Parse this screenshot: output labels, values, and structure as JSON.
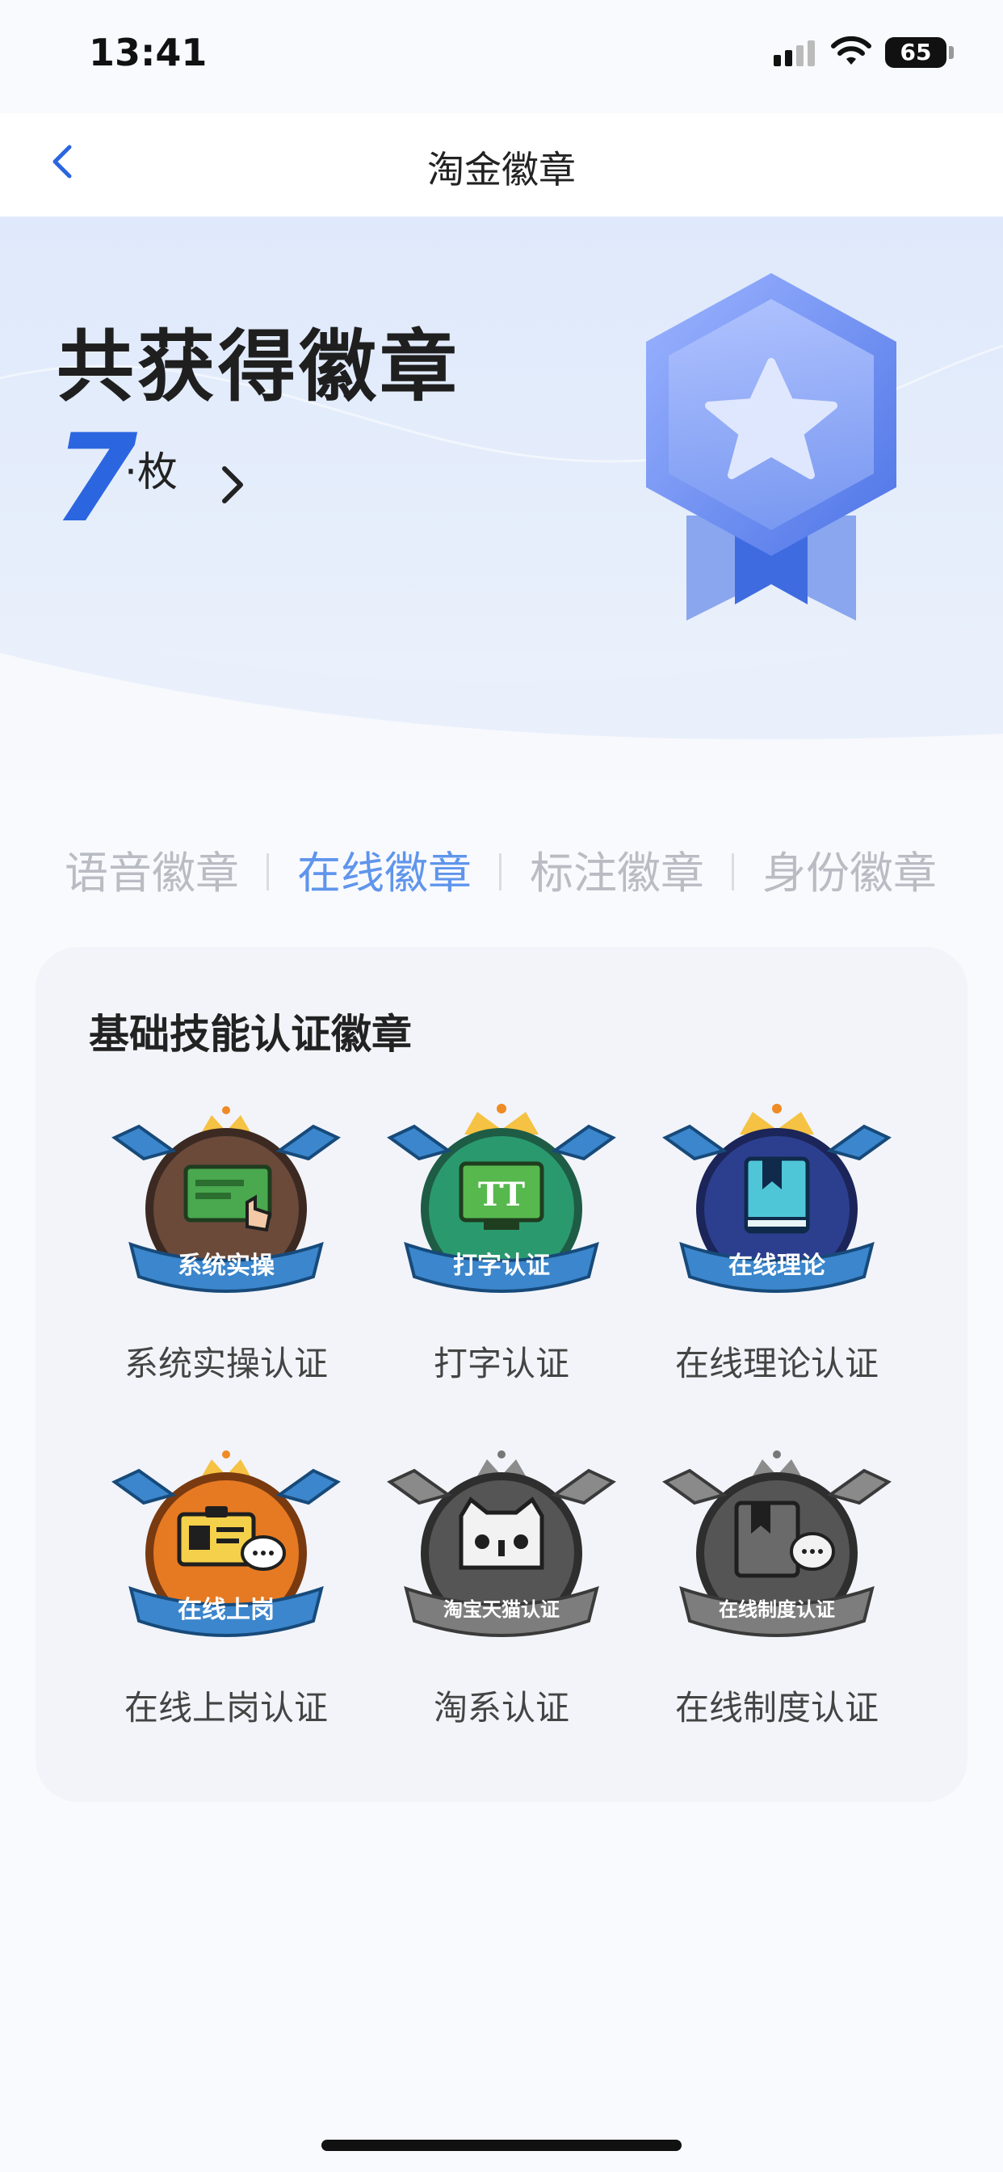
{
  "status_bar": {
    "time": "13:41",
    "battery": "65"
  },
  "nav": {
    "title": "淘金徽章"
  },
  "hero": {
    "title": "共获得徽章",
    "count": "7",
    "unit": "·枚"
  },
  "tabs": [
    {
      "label": "语音徽章",
      "active": false
    },
    {
      "label": "在线徽章",
      "active": true
    },
    {
      "label": "标注徽章",
      "active": false
    },
    {
      "label": "身份徽章",
      "active": false
    }
  ],
  "section": {
    "title": "基础技能认证徽章",
    "badges": [
      {
        "label": "系统实操认证",
        "ribbon": "系统实操",
        "icon": "screen-hand-icon",
        "color": "#6b4a3a",
        "earned": true
      },
      {
        "label": "打字认证",
        "ribbon": "打字认证",
        "icon": "typing-tt-icon",
        "color": "#2a9a6e",
        "earned": true
      },
      {
        "label": "在线理论认证",
        "ribbon": "在线理论",
        "icon": "book-icon",
        "color": "#2c3f8f",
        "earned": true
      },
      {
        "label": "在线上岗认证",
        "ribbon": "在线上岗",
        "icon": "id-card-chat-icon",
        "color": "#e67a22",
        "earned": true
      },
      {
        "label": "淘系认证",
        "ribbon": "淘宝天猫认证",
        "icon": "tmall-cat-icon",
        "color": "#4a4a4a",
        "earned": false
      },
      {
        "label": "在线制度认证",
        "ribbon": "在线制度认证",
        "icon": "book-chat-icon",
        "color": "#4a4a4a",
        "earned": false
      }
    ]
  }
}
